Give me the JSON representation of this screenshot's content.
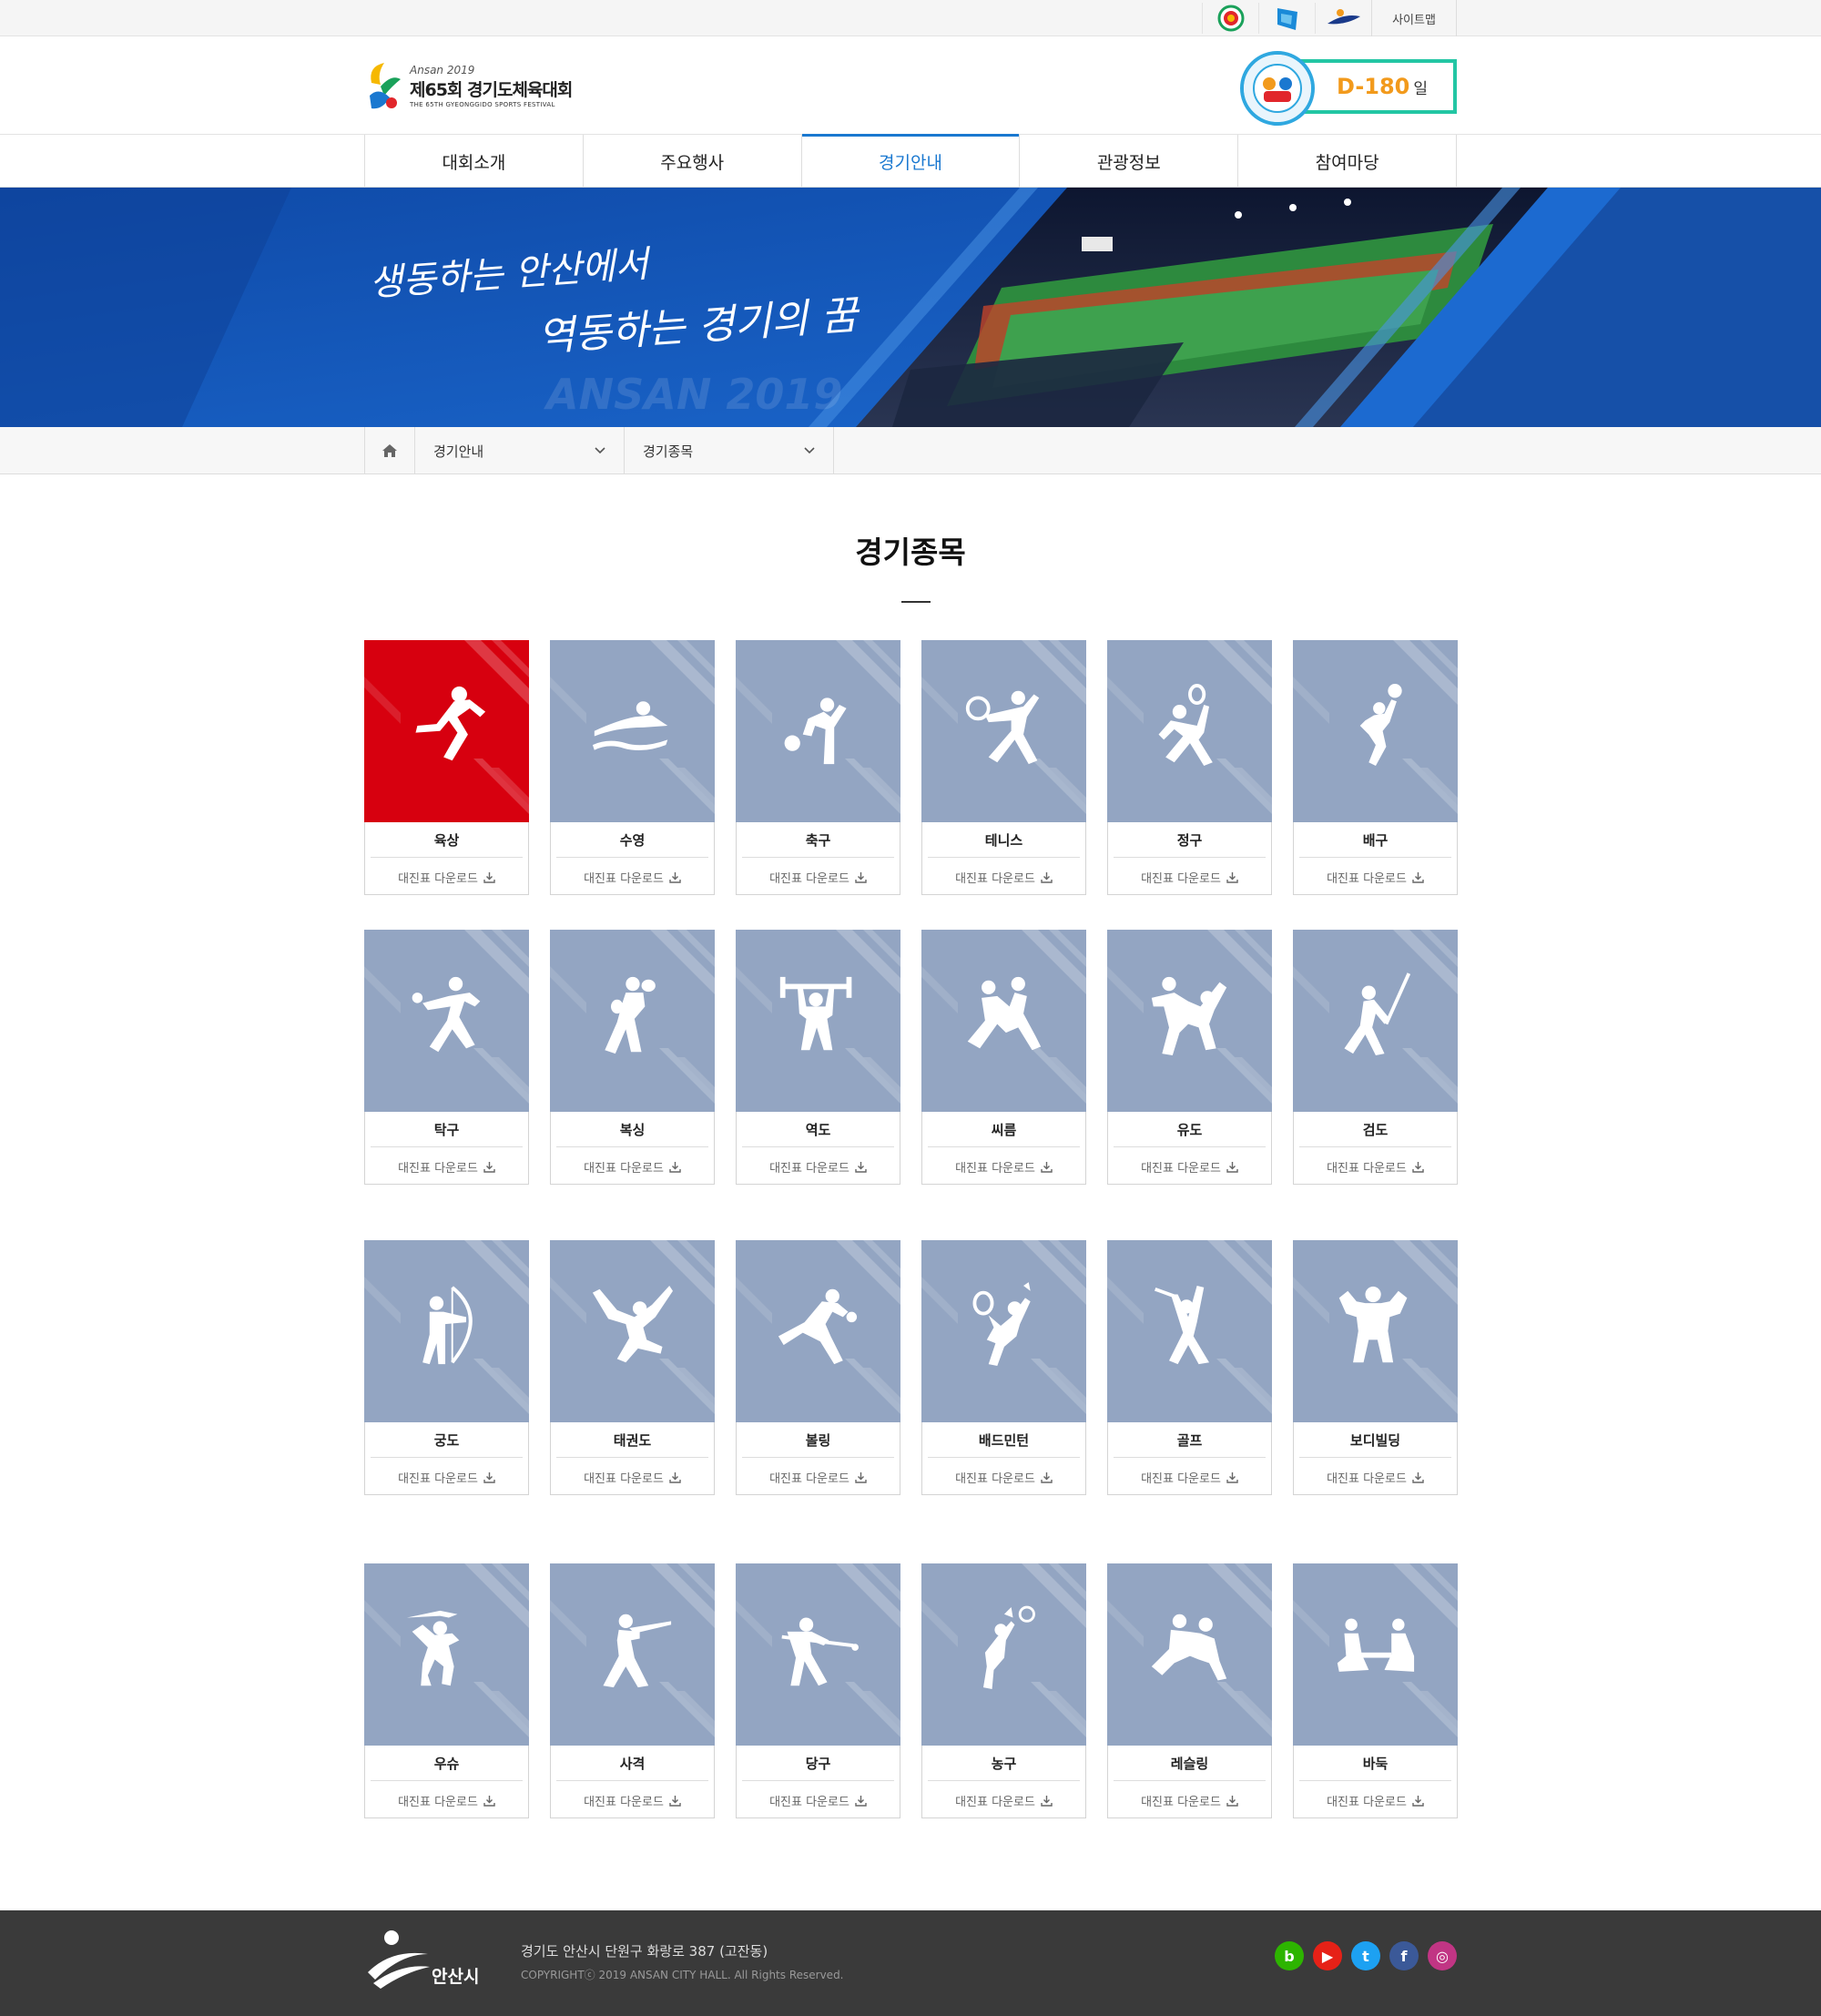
{
  "util": {
    "icons": [
      "emblem-icon",
      "flag-icon",
      "mascot-icon"
    ],
    "sitemap_label": "사이트맵"
  },
  "header": {
    "logo_small": "Ansan 2019",
    "logo_main": "제65회 경기도체육대회",
    "logo_sub": "THE 65TH GYEONGGIDO SPORTS FESTIVAL",
    "dday_value": "D-180",
    "dday_unit": "일",
    "accent_color": "#f29a1c",
    "box_color": "#23c6a4"
  },
  "gnb": {
    "items": [
      "대회소개",
      "주요행사",
      "경기안내",
      "관광정보",
      "참여마당"
    ],
    "active_index": 2,
    "active_color": "#1a78d0"
  },
  "banner": {
    "slogan_line1": "생동하는 안산에서",
    "slogan_line2": "역동하는 경기의 꿈",
    "watermark": "ANSAN 2019"
  },
  "subnav": {
    "home_icon": "home-icon",
    "menu1": "경기안내",
    "menu2": "경기종목"
  },
  "page": {
    "title": "경기종목"
  },
  "sports": {
    "download_label": "대진표 다운로드",
    "active_color": "#d7000f",
    "card_color": "#93a5c2",
    "items": [
      {
        "name": "육상",
        "icon": "athletics-icon"
      },
      {
        "name": "수영",
        "icon": "swimming-icon"
      },
      {
        "name": "축구",
        "icon": "soccer-icon"
      },
      {
        "name": "테니스",
        "icon": "tennis-icon"
      },
      {
        "name": "정구",
        "icon": "soft-tennis-icon"
      },
      {
        "name": "배구",
        "icon": "volleyball-icon"
      },
      {
        "name": "탁구",
        "icon": "table-tennis-icon"
      },
      {
        "name": "복싱",
        "icon": "boxing-icon"
      },
      {
        "name": "역도",
        "icon": "weightlifting-icon"
      },
      {
        "name": "씨름",
        "icon": "ssireum-icon"
      },
      {
        "name": "유도",
        "icon": "judo-icon"
      },
      {
        "name": "검도",
        "icon": "kendo-icon"
      },
      {
        "name": "궁도",
        "icon": "archery-icon"
      },
      {
        "name": "태권도",
        "icon": "taekwondo-icon"
      },
      {
        "name": "볼링",
        "icon": "bowling-icon"
      },
      {
        "name": "배드민턴",
        "icon": "badminton-icon"
      },
      {
        "name": "골프",
        "icon": "golf-icon"
      },
      {
        "name": "보디빌딩",
        "icon": "bodybuilding-icon"
      },
      {
        "name": "우슈",
        "icon": "wushu-icon"
      },
      {
        "name": "사격",
        "icon": "shooting-icon"
      },
      {
        "name": "당구",
        "icon": "billiards-icon"
      },
      {
        "name": "농구",
        "icon": "basketball-icon"
      },
      {
        "name": "레슬링",
        "icon": "wrestling-icon"
      },
      {
        "name": "바둑",
        "icon": "baduk-icon"
      }
    ]
  },
  "footer": {
    "logo_text": "안산시",
    "address": "경기도 안산시 단원구 화랑로 387 (고잔동)",
    "copyright": "COPYRIGHTⓒ 2019 ANSAN CITY HALL. All Rights Reserved.",
    "sns": [
      {
        "name": "blog-icon",
        "glyph": "b",
        "color": "#2db400"
      },
      {
        "name": "youtube-icon",
        "glyph": "▶",
        "color": "#e62117"
      },
      {
        "name": "twitter-icon",
        "glyph": "t",
        "color": "#1da1f2"
      },
      {
        "name": "facebook-icon",
        "glyph": "f",
        "color": "#3b5998"
      },
      {
        "name": "instagram-icon",
        "glyph": "◎",
        "color": "#c13584"
      }
    ]
  }
}
